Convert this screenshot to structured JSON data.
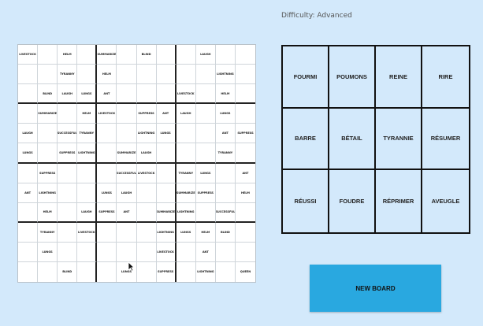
{
  "header": {
    "difficulty": "Difficulty: Advanced"
  },
  "grid": {
    "rows": [
      [
        "LIVESTOCK",
        "",
        "HELM",
        "",
        "SUMMARIZE",
        "",
        "BLIND",
        "",
        "",
        "LAUGH",
        "",
        ""
      ],
      [
        "",
        "",
        "TYRANNY",
        "",
        "HELM",
        "",
        "",
        "",
        "",
        "",
        "LIGHTNING",
        ""
      ],
      [
        "",
        "BLIND",
        "LAUGH",
        "LUNGS",
        "ANT",
        "",
        "",
        "",
        "LIVESTOCK",
        "",
        "HELM",
        ""
      ],
      [
        "",
        "SUMMARIZE",
        "",
        "HELM",
        "LIVESTOCK",
        "",
        "SUPPRESS",
        "ANT",
        "LAUGH",
        "",
        "LUNGS",
        ""
      ],
      [
        "LAUGH",
        "",
        "SUCCESSFUL",
        "TYRANNY",
        "",
        "",
        "LIGHTNING",
        "LUNGS",
        "",
        "",
        "ANT",
        "SUPPRESS"
      ],
      [
        "LUNGS",
        "",
        "SUPPRESS",
        "LIGHTNING",
        "",
        "SUMMARIZE",
        "LAUGH",
        "",
        "",
        "",
        "TYRANNY",
        ""
      ],
      [
        "",
        "SUPPRESS",
        "",
        "",
        "",
        "SUCCESSFUL",
        "LIVESTOCK",
        "",
        "TYRANNY",
        "LUNGS",
        "",
        "ANT"
      ],
      [
        "ANT",
        "LIGHTNING",
        "",
        "",
        "LUNGS",
        "LAUGH",
        "",
        "",
        "SUMMARIZE",
        "SUPPRESS",
        "",
        "HELM"
      ],
      [
        "",
        "HELM",
        "",
        "LAUGH",
        "SUPPRESS",
        "ANT",
        "",
        "SUMMARIZE",
        "LIGHTNING",
        "",
        "SUCCESSFUL",
        ""
      ],
      [
        "",
        "TYRANNY",
        "",
        "LIVESTOCK",
        "",
        "",
        "",
        "LIGHTNING",
        "LUNGS",
        "HELM",
        "BLIND",
        ""
      ],
      [
        "",
        "LUNGS",
        "",
        "",
        "",
        "",
        "",
        "LIVESTOCK",
        "",
        "ANT",
        "",
        ""
      ],
      [
        "",
        "",
        "BLIND",
        "",
        "",
        "LUNGS",
        "",
        "SUPPRESS",
        "",
        "LIGHTNING",
        "",
        "QUEEN"
      ]
    ]
  },
  "words": [
    "FOURMI",
    "POUMONS",
    "REINE",
    "RIRE",
    "BARRE",
    "BÉTAIL",
    "TYRANNIE",
    "RÉSUMER",
    "RÉUSSI",
    "FOUDRE",
    "RÉPRIMER",
    "AVEUGLE"
  ],
  "actions": {
    "new_board": "NEW BOARD"
  },
  "colors": {
    "background": "#d3e9fb",
    "button": "#29a8e0"
  }
}
